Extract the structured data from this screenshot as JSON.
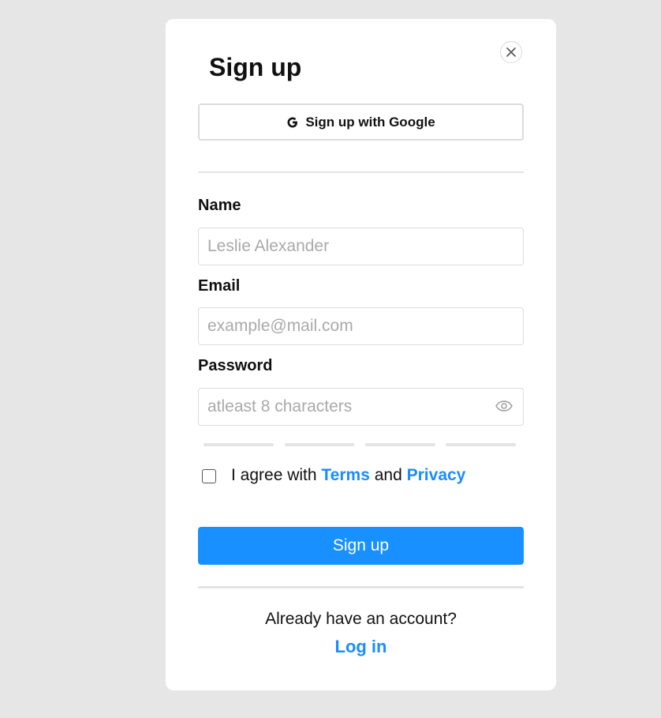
{
  "modal": {
    "title": "Sign up",
    "close_icon": "close-icon"
  },
  "google": {
    "label": "Sign up with Google",
    "icon": "google-g-icon"
  },
  "form": {
    "name": {
      "label": "Name",
      "placeholder": "Leslie Alexander",
      "value": ""
    },
    "email": {
      "label": "Email",
      "placeholder": "example@mail.com",
      "value": ""
    },
    "password": {
      "label": "Password",
      "placeholder": "atleast 8 characters",
      "value": "",
      "toggle_icon": "eye-icon"
    },
    "password_strength": {
      "segments": 4,
      "filled": 0
    }
  },
  "agreement": {
    "checked": false,
    "prefix": "I agree with",
    "terms": "Terms",
    "and": "and",
    "privacy": "Privacy"
  },
  "submit": {
    "label": "Sign up"
  },
  "footer": {
    "prompt": "Already have an account?",
    "login": "Log in"
  },
  "colors": {
    "accent": "#1890ff",
    "link": "#1a8cff",
    "background": "#e6e6e6",
    "card": "#ffffff"
  }
}
